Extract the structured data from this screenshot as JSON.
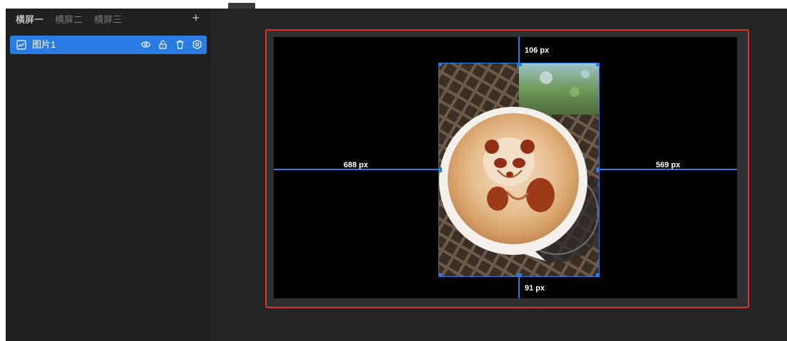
{
  "sidebar": {
    "tabs": [
      {
        "label": "横屏一",
        "active": true
      },
      {
        "label": "横屏二",
        "active": false
      },
      {
        "label": "横屏三",
        "active": false
      }
    ],
    "add_label": "+",
    "layers": [
      {
        "label": "图片1",
        "icon": "image-icon",
        "selected": true,
        "actions": [
          "eye-icon",
          "lock-icon",
          "trash-icon",
          "settings-icon"
        ]
      }
    ]
  },
  "canvas": {
    "selected_element": "图片1",
    "image_content": "latte art panda coffee",
    "distances": {
      "top": "106 px",
      "bottom": "91 px",
      "left": "688 px",
      "right": "569 px"
    }
  },
  "colors": {
    "accent": "#2a7be2",
    "frame_border": "#e0302b",
    "canvas_bg": "#000000",
    "sidebar_bg": "#202020"
  }
}
